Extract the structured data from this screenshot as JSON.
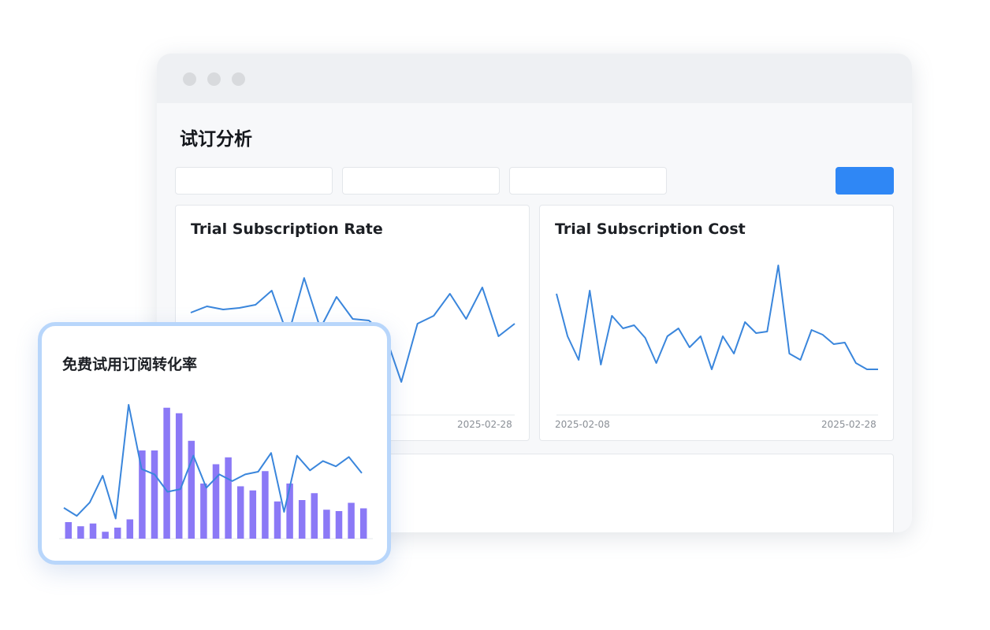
{
  "window": {
    "title": "试订分析"
  },
  "filters": [
    {
      "value": "",
      "placeholder": ""
    },
    {
      "value": "",
      "placeholder": ""
    },
    {
      "value": "",
      "placeholder": ""
    }
  ],
  "primary_button": {
    "label": ""
  },
  "colors": {
    "accent": "#2f87f5",
    "line": "#3a86dc",
    "bar": "#8b79f6",
    "popup_border": "#b8d6fb"
  },
  "chart_data": [
    {
      "type": "line",
      "title": "Trial Subscription Rate",
      "x_tick_labels": [
        "2025-02-08",
        "2025-02-28"
      ],
      "x": [
        "2025-02-08",
        "2025-02-09",
        "2025-02-10",
        "2025-02-11",
        "2025-02-12",
        "2025-02-13",
        "2025-02-14",
        "2025-02-15",
        "2025-02-16",
        "2025-02-17",
        "2025-02-18",
        "2025-02-19",
        "2025-02-20",
        "2025-02-21",
        "2025-02-22",
        "2025-02-23",
        "2025-02-24",
        "2025-02-25",
        "2025-02-26",
        "2025-02-27",
        "2025-02-28"
      ],
      "values": [
        0.62,
        0.66,
        0.64,
        0.65,
        0.67,
        0.76,
        0.47,
        0.84,
        0.52,
        0.72,
        0.58,
        0.57,
        0.48,
        0.18,
        0.55,
        0.6,
        0.74,
        0.58,
        0.78,
        0.47,
        0.55
      ],
      "ylim": [
        0,
        1
      ]
    },
    {
      "type": "line",
      "title": "Trial Subscription Cost",
      "x_tick_labels": [
        "2025-02-08",
        "2025-02-28"
      ],
      "x": [
        "2025-02-08",
        "2025-02-09",
        "2025-02-10",
        "2025-02-11",
        "2025-02-12",
        "2025-02-13",
        "2025-02-14",
        "2025-02-15",
        "2025-02-16",
        "2025-02-17",
        "2025-02-18",
        "2025-02-19",
        "2025-02-20",
        "2025-02-21",
        "2025-02-22",
        "2025-02-23",
        "2025-02-24",
        "2025-02-25",
        "2025-02-26",
        "2025-02-27",
        "2025-02-28"
      ],
      "values": [
        0.74,
        0.47,
        0.32,
        0.76,
        0.29,
        0.6,
        0.52,
        0.54,
        0.46,
        0.3,
        0.47,
        0.52,
        0.4,
        0.47,
        0.26,
        0.47,
        0.36,
        0.56,
        0.49,
        0.5,
        0.92,
        0.36,
        0.32,
        0.51,
        0.48,
        0.42,
        0.43,
        0.3,
        0.26,
        0.26
      ],
      "ylim": [
        0,
        1
      ]
    },
    {
      "type": "bar",
      "title": "免费试用订阅转化率",
      "values": [
        0.12,
        0.09,
        0.11,
        0.05,
        0.08,
        0.14,
        0.64,
        0.64,
        0.95,
        0.91,
        0.71,
        0.4,
        0.54,
        0.59,
        0.38,
        0.35,
        0.49,
        0.27,
        0.4,
        0.28,
        0.33,
        0.21,
        0.2,
        0.26,
        0.22
      ],
      "line_values": [
        0.23,
        0.17,
        0.27,
        0.47,
        0.15,
        1.0,
        0.52,
        0.48,
        0.35,
        0.37,
        0.62,
        0.38,
        0.48,
        0.43,
        0.48,
        0.5,
        0.64,
        0.2,
        0.62,
        0.51,
        0.58,
        0.54,
        0.61,
        0.49
      ],
      "ylim": [
        0,
        1
      ]
    }
  ]
}
